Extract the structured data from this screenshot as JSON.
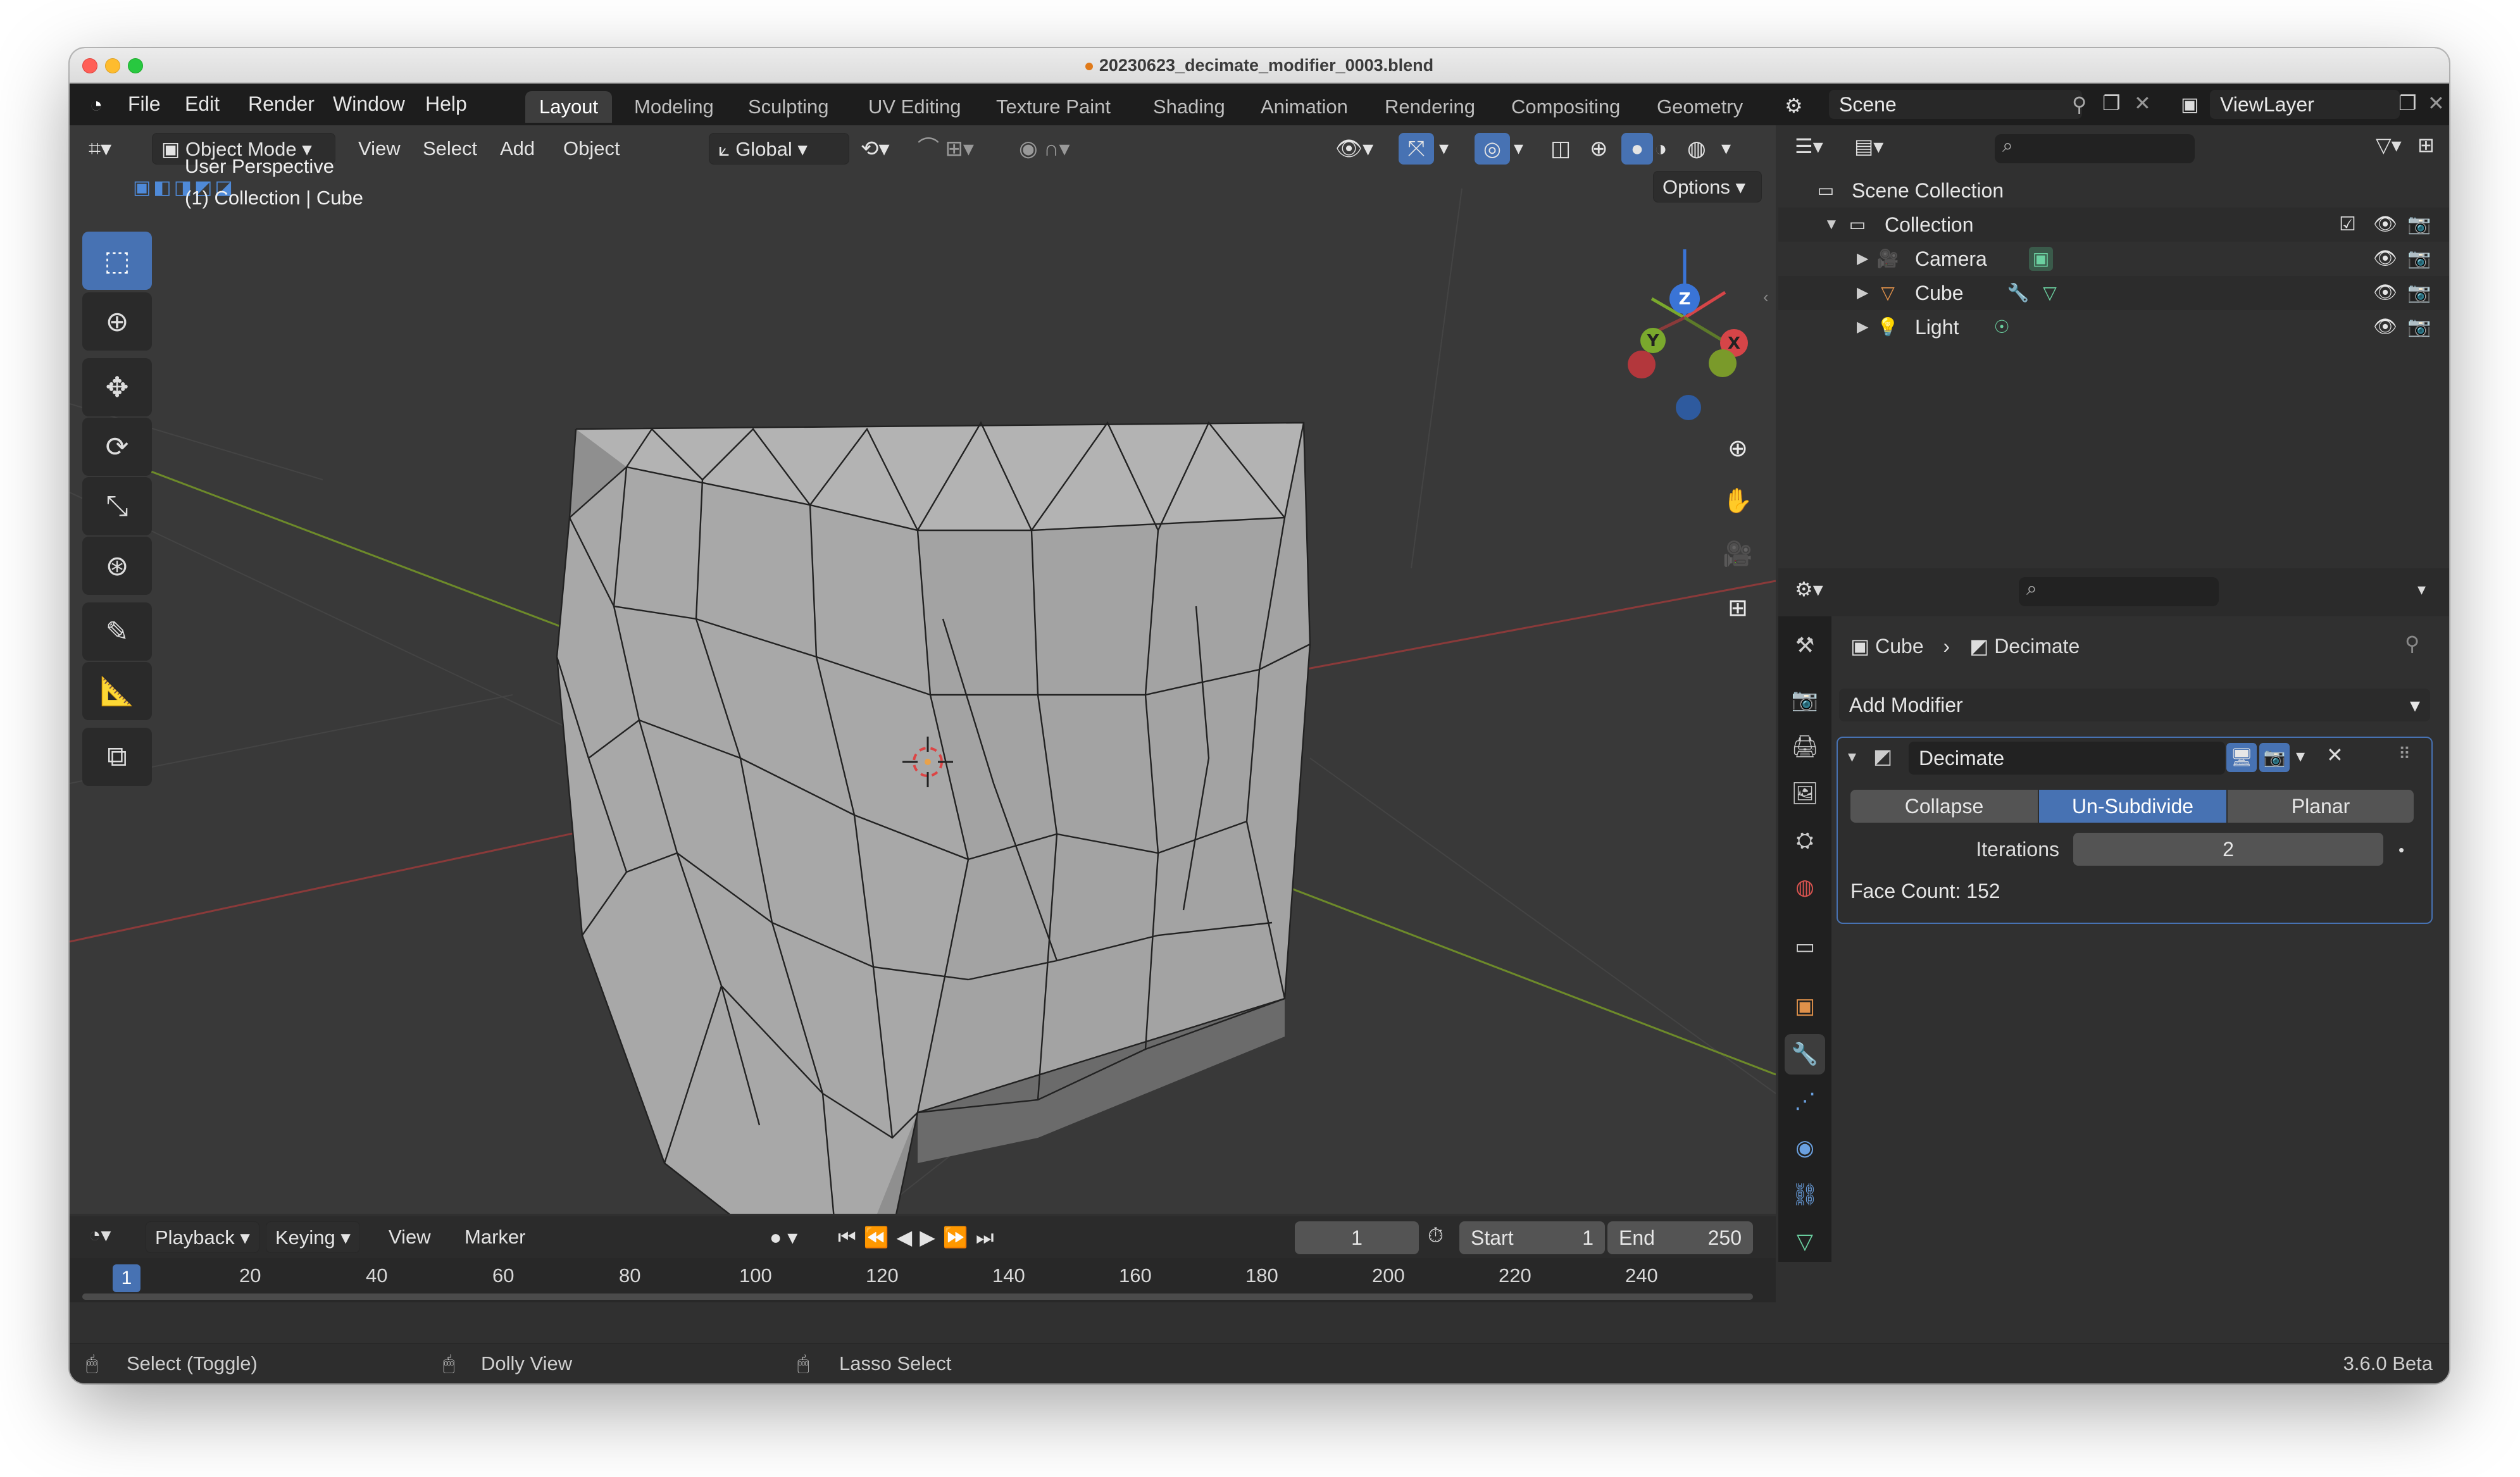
{
  "window": {
    "title": "20230623_decimate_modifier_0003.blend"
  },
  "menu": {
    "items": [
      "File",
      "Edit",
      "Render",
      "Window",
      "Help"
    ]
  },
  "workspaces": {
    "active": "Layout",
    "tabs": [
      "Layout",
      "Modeling",
      "Sculpting",
      "UV Editing",
      "Texture Paint",
      "Shading",
      "Animation",
      "Rendering",
      "Compositing",
      "Geometry"
    ]
  },
  "scene_bar": {
    "scene": "Scene",
    "view_layer": "ViewLayer"
  },
  "viewport": {
    "header": {
      "mode": "Object Mode",
      "view": "View",
      "select": "Select",
      "add": "Add",
      "object": "Object",
      "orientation": "Global",
      "options": "Options"
    },
    "info": {
      "line1": "User Perspective",
      "line2": "(1) Collection | Cube"
    },
    "gizmo": {
      "z": "Z",
      "y": "Y",
      "x": "X"
    }
  },
  "outliner": {
    "rows": [
      {
        "label": "Scene Collection"
      },
      {
        "label": "Collection"
      },
      {
        "label": "Camera"
      },
      {
        "label": "Cube"
      },
      {
        "label": "Light"
      }
    ]
  },
  "properties": {
    "breadcrumb": {
      "object": "Cube",
      "modifier": "Decimate"
    },
    "add_modifier": "Add Modifier",
    "modifier": {
      "name": "Decimate",
      "modes": [
        "Collapse",
        "Un-Subdivide",
        "Planar"
      ],
      "active_mode": "Un-Subdivide",
      "iterations_label": "Iterations",
      "iterations_value": "2",
      "face_count": "Face Count: 152"
    }
  },
  "timeline": {
    "menus": [
      "Playback",
      "Keying",
      "View",
      "Marker"
    ],
    "current_frame": "1",
    "start_label": "Start",
    "start": "1",
    "end_label": "End",
    "end": "250",
    "ticks": [
      "1",
      "20",
      "40",
      "60",
      "80",
      "100",
      "120",
      "140",
      "160",
      "180",
      "200",
      "220",
      "240"
    ]
  },
  "statusbar": {
    "select": "Select (Toggle)",
    "dolly": "Dolly View",
    "lasso": "Lasso Select",
    "version": "3.6.0 Beta"
  }
}
